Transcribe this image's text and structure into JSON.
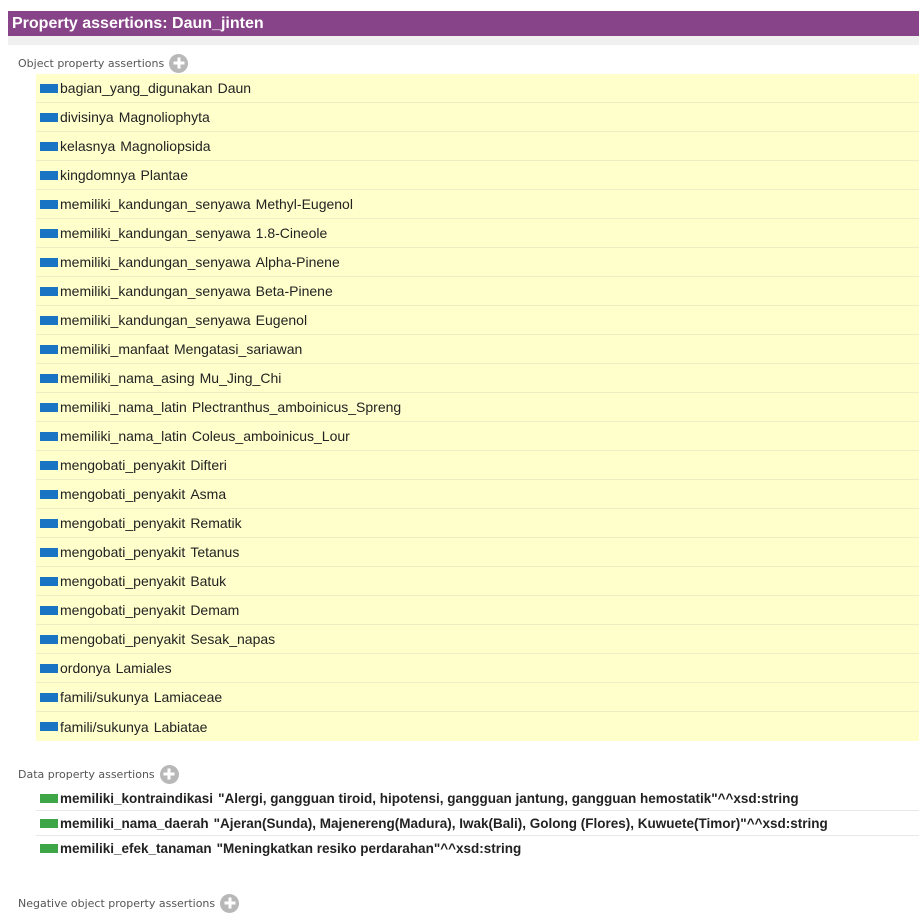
{
  "title": "Property assertions: Daun_jinten",
  "colors": {
    "title_bar": "#884488",
    "object_row_bg": "#ffffcc",
    "object_property_swatch": "#1a74c4",
    "data_property_swatch": "#3ea646",
    "add_button": "#b8b8b8"
  },
  "object_section": {
    "label": "Object property assertions",
    "add_icon": "plus-circle-icon",
    "items": [
      {
        "property": "bagian_yang_digunakan",
        "value": "Daun"
      },
      {
        "property": "divisinya",
        "value": "Magnoliophyta"
      },
      {
        "property": "kelasnya",
        "value": "Magnoliopsida"
      },
      {
        "property": "kingdomnya",
        "value": "Plantae"
      },
      {
        "property": "memiliki_kandungan_senyawa",
        "value": "Methyl-Eugenol"
      },
      {
        "property": "memiliki_kandungan_senyawa",
        "value": "1.8-Cineole"
      },
      {
        "property": "memiliki_kandungan_senyawa",
        "value": "Alpha-Pinene"
      },
      {
        "property": "memiliki_kandungan_senyawa",
        "value": "Beta-Pinene"
      },
      {
        "property": "memiliki_kandungan_senyawa",
        "value": "Eugenol"
      },
      {
        "property": "memiliki_manfaat",
        "value": "Mengatasi_sariawan"
      },
      {
        "property": "memiliki_nama_asing",
        "value": "Mu_Jing_Chi"
      },
      {
        "property": "memiliki_nama_latin",
        "value": "Plectranthus_amboinicus_Spreng"
      },
      {
        "property": "memiliki_nama_latin",
        "value": "Coleus_amboinicus_Lour"
      },
      {
        "property": "mengobati_penyakit",
        "value": "Difteri"
      },
      {
        "property": "mengobati_penyakit",
        "value": "Asma"
      },
      {
        "property": "mengobati_penyakit",
        "value": "Rematik"
      },
      {
        "property": "mengobati_penyakit",
        "value": "Tetanus"
      },
      {
        "property": "mengobati_penyakit",
        "value": "Batuk"
      },
      {
        "property": "mengobati_penyakit",
        "value": "Demam"
      },
      {
        "property": "mengobati_penyakit",
        "value": "Sesak_napas"
      },
      {
        "property": "ordonya",
        "value": "Lamiales"
      },
      {
        "property": "famili/sukunya",
        "value": "Lamiaceae"
      },
      {
        "property": "famili/sukunya",
        "value": "Labiatae"
      }
    ]
  },
  "data_section": {
    "label": "Data property assertions",
    "add_icon": "plus-circle-icon",
    "items": [
      {
        "property": "memiliki_kontraindikasi",
        "value": "\"Alergi, gangguan tiroid, hipotensi, gangguan jantung, gangguan hemostatik\"^^xsd:string"
      },
      {
        "property": "memiliki_nama_daerah",
        "value": "\"Ajeran(Sunda), Majenereng(Madura), Iwak(Bali), Golong (Flores), Kuwuete(Timor)\"^^xsd:string"
      },
      {
        "property": "memiliki_efek_tanaman",
        "value": "\"Meningkatkan resiko perdarahan\"^^xsd:string"
      }
    ]
  },
  "negative_section": {
    "label": "Negative object property assertions",
    "add_icon": "plus-circle-icon"
  }
}
